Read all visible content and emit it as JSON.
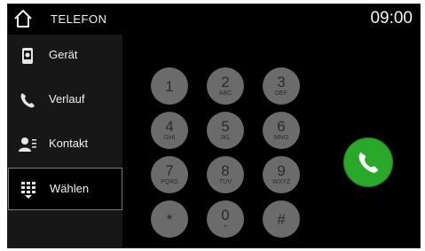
{
  "header": {
    "title": "TELEFON",
    "time": "09:00"
  },
  "sidebar": {
    "items": [
      {
        "label": "Gerät",
        "icon": "phone-device-icon"
      },
      {
        "label": "Verlauf",
        "icon": "phone-handset-icon"
      },
      {
        "label": "Kontakt",
        "icon": "contact-icon"
      },
      {
        "label": "Wählen",
        "icon": "dialpad-icon",
        "selected": true
      }
    ]
  },
  "keypad": {
    "keys": [
      {
        "digit": "1",
        "letters": ""
      },
      {
        "digit": "2",
        "letters": "ABC"
      },
      {
        "digit": "3",
        "letters": "DEF"
      },
      {
        "digit": "4",
        "letters": "GHI"
      },
      {
        "digit": "5",
        "letters": "JKL"
      },
      {
        "digit": "6",
        "letters": "MNO"
      },
      {
        "digit": "7",
        "letters": "PQRS"
      },
      {
        "digit": "8",
        "letters": "TUV"
      },
      {
        "digit": "9",
        "letters": "WXYZ"
      },
      {
        "digit": "*",
        "letters": ""
      },
      {
        "digit": "0",
        "letters": "+"
      },
      {
        "digit": "#",
        "letters": ""
      }
    ]
  },
  "call_button": {
    "icon": "call-icon",
    "color": "#2aa82a"
  }
}
